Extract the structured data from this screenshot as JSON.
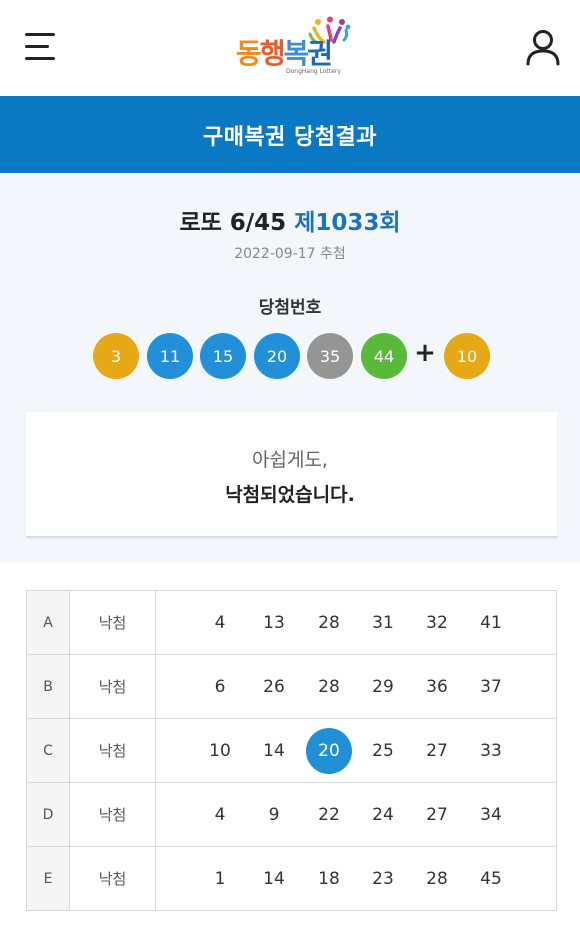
{
  "header": {
    "logo": {
      "chars": [
        "동",
        "행",
        "복",
        "권"
      ],
      "sub": "DongHang Lottery"
    }
  },
  "title_bar": {
    "title": "구매복권 당첨결과"
  },
  "draw": {
    "game": "로또 6/45",
    "round": "제1033회",
    "date": "2022-09-17 추첨",
    "win_label": "당첨번호",
    "numbers": [
      "3",
      "11",
      "15",
      "20",
      "35",
      "44"
    ],
    "bonus": "10",
    "plus": "+"
  },
  "colors": {
    "primary": "#0a78c2",
    "ball_yellow": "#e6a817",
    "ball_blue": "#2290d9",
    "ball_gray": "#959595",
    "ball_green": "#59ba3a",
    "hit": "#1f8fd6"
  },
  "message": {
    "line1": "아쉽게도,",
    "line2": "낙첨되었습니다."
  },
  "tickets": [
    {
      "letter": "A",
      "result": "낙첨",
      "numbers": [
        "4",
        "13",
        "28",
        "31",
        "32",
        "41"
      ]
    },
    {
      "letter": "B",
      "result": "낙첨",
      "numbers": [
        "6",
        "26",
        "28",
        "29",
        "36",
        "37"
      ]
    },
    {
      "letter": "C",
      "result": "낙첨",
      "numbers": [
        "10",
        "14",
        "20",
        "25",
        "27",
        "33"
      ]
    },
    {
      "letter": "D",
      "result": "낙첨",
      "numbers": [
        "4",
        "9",
        "22",
        "24",
        "27",
        "34"
      ]
    },
    {
      "letter": "E",
      "result": "낙첨",
      "numbers": [
        "1",
        "14",
        "18",
        "23",
        "28",
        "45"
      ]
    }
  ]
}
